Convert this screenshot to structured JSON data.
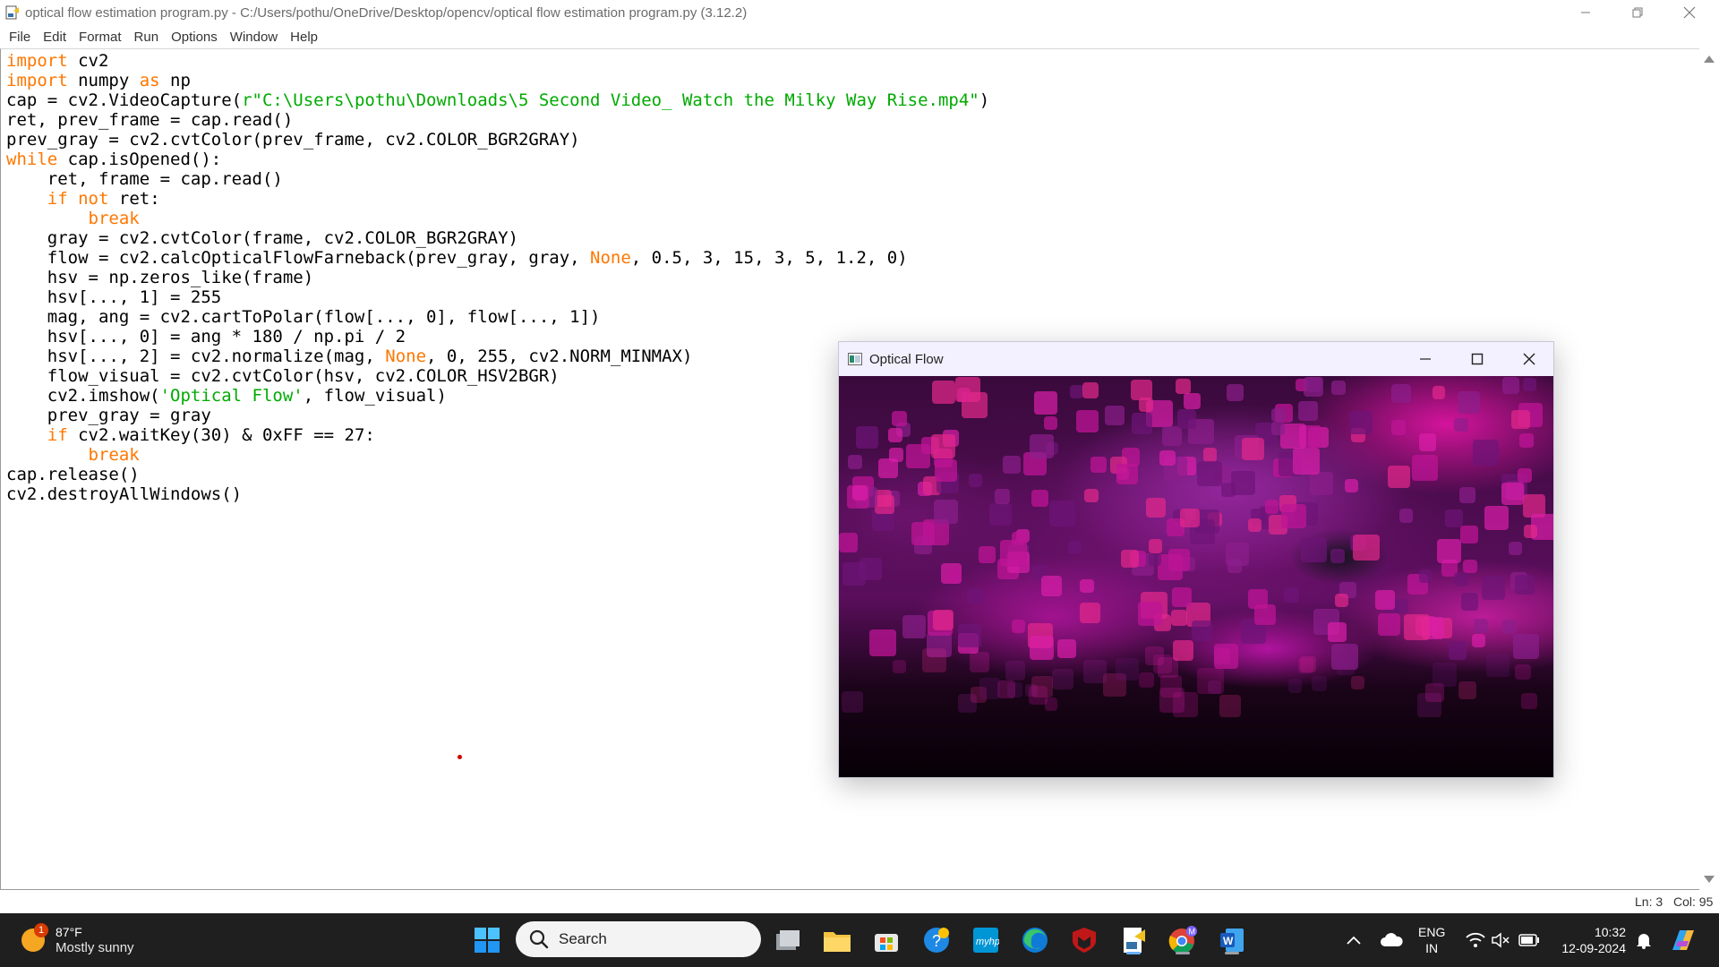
{
  "window": {
    "title": "optical flow estimation program.py - C:/Users/pothu/OneDrive/Desktop/opencv/optical flow estimation program.py (3.12.2)"
  },
  "menu": [
    "File",
    "Edit",
    "Format",
    "Run",
    "Options",
    "Window",
    "Help"
  ],
  "code_lines": [
    [
      {
        "t": "import",
        "c": "kw"
      },
      {
        "t": " cv2"
      }
    ],
    [
      {
        "t": "import",
        "c": "kw"
      },
      {
        "t": " numpy "
      },
      {
        "t": "as",
        "c": "kw"
      },
      {
        "t": " np"
      }
    ],
    [
      {
        "t": "cap = cv2.VideoCapture("
      },
      {
        "t": "r\"C:\\Users\\pothu\\Downloads\\5 Second Video_ Watch the Milky Way Rise.mp4\"",
        "c": "st"
      },
      {
        "t": ")"
      }
    ],
    [
      {
        "t": "ret, prev_frame = cap.read()"
      }
    ],
    [
      {
        "t": "prev_gray = cv2.cvtColor(prev_frame, cv2.COLOR_BGR2GRAY)"
      }
    ],
    [
      {
        "t": "while",
        "c": "kw"
      },
      {
        "t": " cap.isOpened():"
      }
    ],
    [
      {
        "t": "    ret, frame = cap.read()"
      }
    ],
    [
      {
        "t": "    "
      },
      {
        "t": "if",
        "c": "kw"
      },
      {
        "t": " "
      },
      {
        "t": "not",
        "c": "kw"
      },
      {
        "t": " ret:"
      }
    ],
    [
      {
        "t": "        "
      },
      {
        "t": "break",
        "c": "kw"
      }
    ],
    [
      {
        "t": "    gray = cv2.cvtColor(frame, cv2.COLOR_BGR2GRAY)"
      }
    ],
    [
      {
        "t": "    flow = cv2.calcOpticalFlowFarneback(prev_gray, gray, "
      },
      {
        "t": "None",
        "c": "kw"
      },
      {
        "t": ", 0.5, 3, 15, 3, 5, 1.2, 0)"
      }
    ],
    [
      {
        "t": "    hsv = np.zeros_like(frame)"
      }
    ],
    [
      {
        "t": "    hsv[..., 1] = 255"
      }
    ],
    [
      {
        "t": "    mag, ang = cv2.cartToPolar(flow[..., 0], flow[..., 1])"
      }
    ],
    [
      {
        "t": "    hsv[..., 0] = ang * 180 / np.pi / 2"
      }
    ],
    [
      {
        "t": "    hsv[..., 2] = cv2.normalize(mag, "
      },
      {
        "t": "None",
        "c": "kw"
      },
      {
        "t": ", 0, 255, cv2.NORM_MINMAX)"
      }
    ],
    [
      {
        "t": "    flow_visual = cv2.cvtColor(hsv, cv2.COLOR_HSV2BGR)"
      }
    ],
    [
      {
        "t": "    cv2.imshow("
      },
      {
        "t": "'Optical Flow'",
        "c": "st"
      },
      {
        "t": ", flow_visual)"
      }
    ],
    [
      {
        "t": "    prev_gray = gray"
      }
    ],
    [
      {
        "t": "    "
      },
      {
        "t": "if",
        "c": "kw"
      },
      {
        "t": " cv2.waitKey(30) & 0xFF == 27:"
      }
    ],
    [
      {
        "t": "        "
      },
      {
        "t": "break",
        "c": "kw"
      }
    ],
    [
      {
        "t": "cap.release()"
      }
    ],
    [
      {
        "t": "cv2.destroyAllWindows()"
      }
    ]
  ],
  "status": {
    "ln": "Ln: 3",
    "col": "Col: 95"
  },
  "flow_window": {
    "title": "Optical Flow"
  },
  "taskbar": {
    "weather": {
      "temp": "87°F",
      "condition": "Mostly sunny",
      "badge": "1"
    },
    "search_placeholder": "Search",
    "lang": {
      "line1": "ENG",
      "line2": "IN"
    },
    "clock": {
      "time": "10:32",
      "date": "12-09-2024"
    },
    "chrome_badge": "M"
  },
  "colors": {
    "keyword": "#ff7700",
    "string": "#00aa00",
    "taskbar_bg": "#1f1f1f",
    "flow_magenta": "#c0149c"
  }
}
